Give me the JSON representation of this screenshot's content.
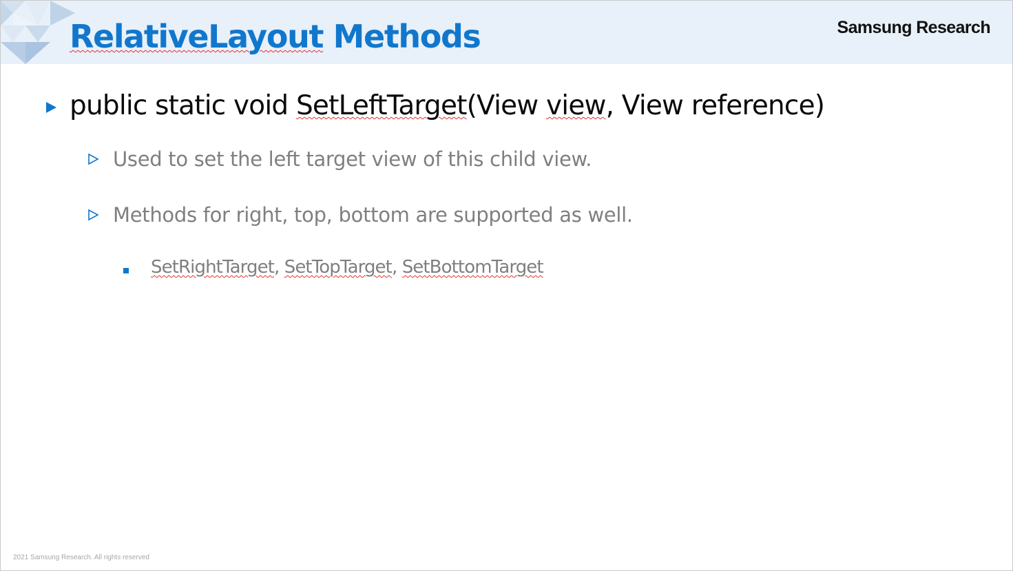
{
  "header": {
    "title_part1": "RelativeLayout",
    "title_part2": " Methods",
    "brand": "Samsung Research"
  },
  "content": {
    "main_bullet": {
      "t1": "public static void ",
      "t2": "SetLeftTarget",
      "t3": "(View ",
      "t4": "view",
      "t5": ", View reference)"
    },
    "sub_bullets": [
      "Used to set the left target view of this child view.",
      "Methods for right, top, bottom are supported as well."
    ],
    "sub_sub_bullet": {
      "method1": "SetRightTarget",
      "sep1": ", ",
      "method2": "SetTopTarget",
      "sep2": ", ",
      "method3": "SetBottomTarget"
    }
  },
  "footer": {
    "copyright": "2021 Samsung Research. All rights reserved"
  },
  "colors": {
    "accent_blue": "#1177cc",
    "header_band": "#e8f0f9",
    "body_gray": "#7f7f7f",
    "spellcheck_red": "#e0302a"
  },
  "icons": {
    "main_bullet": "filled-triangle-right",
    "sub_bullet": "outline-triangle-right",
    "sub_sub_bullet": "filled-square"
  }
}
